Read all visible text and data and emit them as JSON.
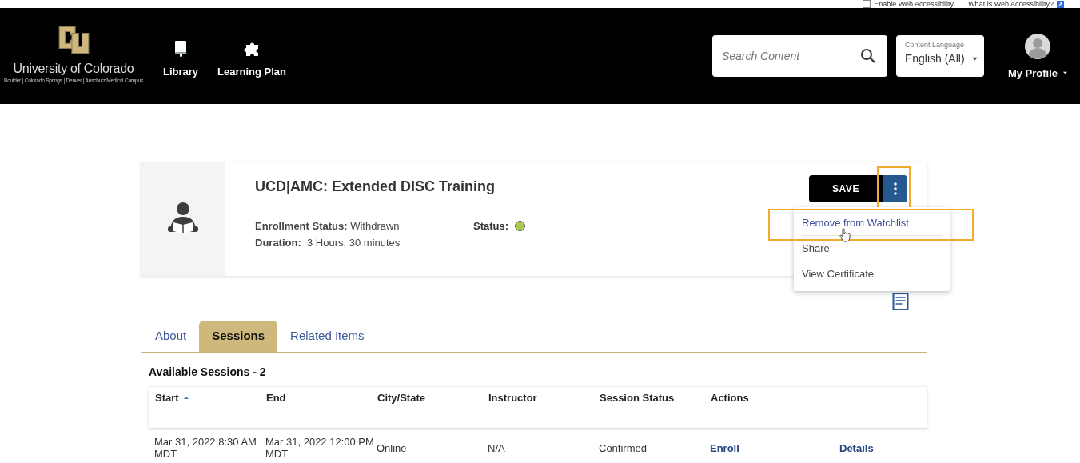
{
  "top_bar": {
    "accessibility_checkbox": {
      "label": "Enable Web Accessibility",
      "checked": false
    },
    "info_link": "What is Web Accessibility?"
  },
  "header": {
    "logo": {
      "name": "University of Colorado",
      "campuses": "Boulder | Colorado Springs | Denver | Anschutz Medical Campus"
    },
    "nav": [
      {
        "label": "Library",
        "kind": "book"
      },
      {
        "label": "Learning Plan",
        "kind": "puzzle"
      }
    ],
    "search": {
      "placeholder": "Search Content"
    },
    "language": {
      "label": "Content Language",
      "value": "English (All)"
    },
    "profile": {
      "label": "My Profile"
    }
  },
  "course": {
    "title": "UCD|AMC: Extended DISC Training",
    "enrollment_label": "Enrollment Status:",
    "enrollment_value": "Withdrawn",
    "duration_label": "Duration:",
    "duration_value": "3 Hours, 30 minutes",
    "status": {
      "label": "Status:",
      "color": "#a9c64f"
    }
  },
  "actions": {
    "save": "SAVE",
    "menu_open": true,
    "menu_highlighted": true,
    "menu": [
      {
        "label": "Remove from Watchlist",
        "highlighted": true
      },
      {
        "label": "Share",
        "highlighted": false
      },
      {
        "label": "View Certificate",
        "highlighted": false
      }
    ]
  },
  "tabs": [
    {
      "label": "About",
      "selected": false
    },
    {
      "label": "Sessions",
      "selected": true
    },
    {
      "label": "Related Items",
      "selected": false
    }
  ],
  "sessions": {
    "title": "Available Sessions - 2",
    "columns": [
      {
        "label": "Start",
        "sorted": true
      },
      {
        "label": "End",
        "sorted": false
      },
      {
        "label": "City/State",
        "sorted": false
      },
      {
        "label": "Instructor",
        "sorted": false
      },
      {
        "label": "Session Status",
        "sorted": false
      },
      {
        "label": "Actions",
        "sorted": false
      }
    ],
    "rows": [
      {
        "start": "Mar 31, 2022 8:30 AM MDT",
        "end": "Mar 31, 2022 12:00 PM MDT",
        "city_state": "Online",
        "instructor": "N/A",
        "session_status": "Confirmed",
        "actions": [
          "Enroll",
          "Details"
        ]
      }
    ]
  }
}
